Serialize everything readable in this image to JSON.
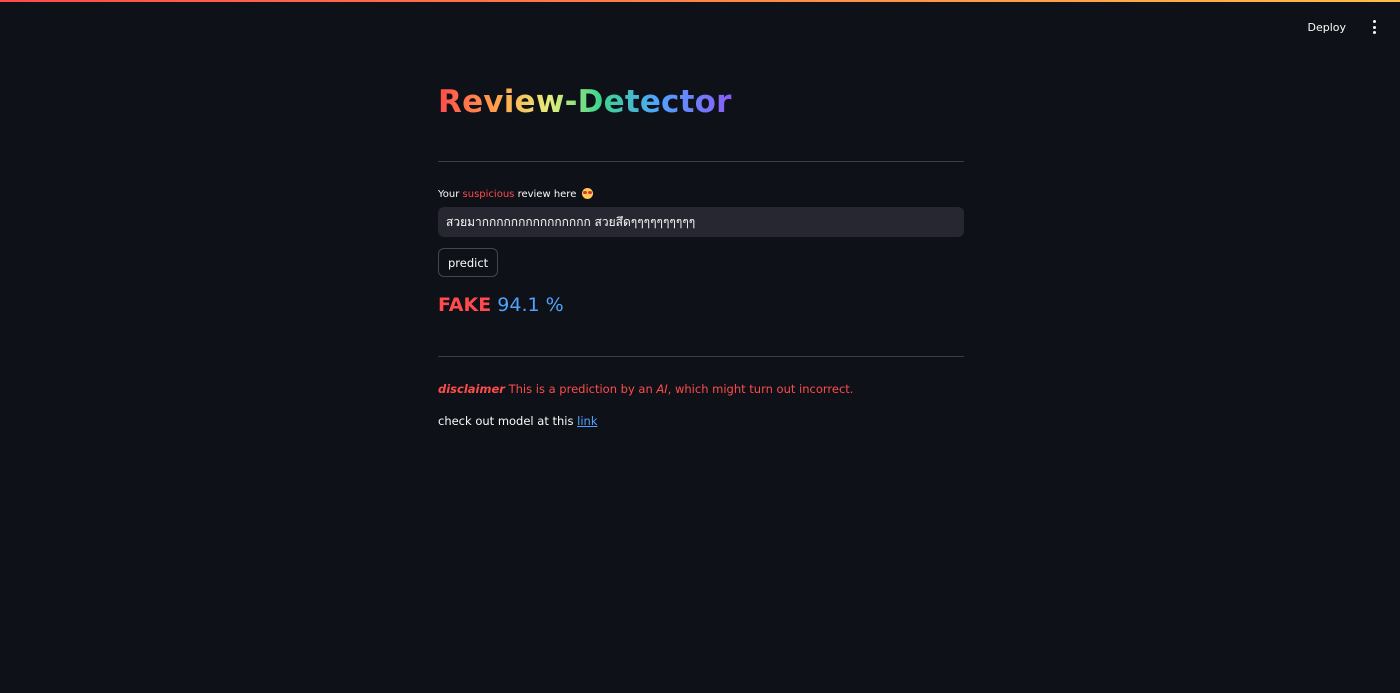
{
  "header": {
    "deploy_label": "Deploy",
    "menu_icon": "vertical-ellipsis-icon"
  },
  "main": {
    "title": "Review-Detector",
    "input": {
      "label_prefix": "Your",
      "label_accent": "suspicious",
      "label_suffix": "review here",
      "label_emoji": "star-struck-emoji-icon",
      "value": "สวยมากกกกกกกกกกกกกกก สวยสึดๆๆๆๆๆๆๆๆๆๆ"
    },
    "predict_label": "predict",
    "result": {
      "verdict": "FAKE",
      "score": "94.1 %"
    },
    "disclaimer": {
      "lead": "disclaimer",
      "text_before": "This is a prediction by an",
      "ai": "AI",
      "text_after": ", which might turn out incorrect."
    },
    "model_link": {
      "text": "check out model at this",
      "link_label": "link"
    }
  },
  "colors": {
    "background": "#0e1117",
    "accent_red": "#ff4b4b",
    "accent_blue": "#4fa3ff",
    "input_background": "#262730"
  }
}
